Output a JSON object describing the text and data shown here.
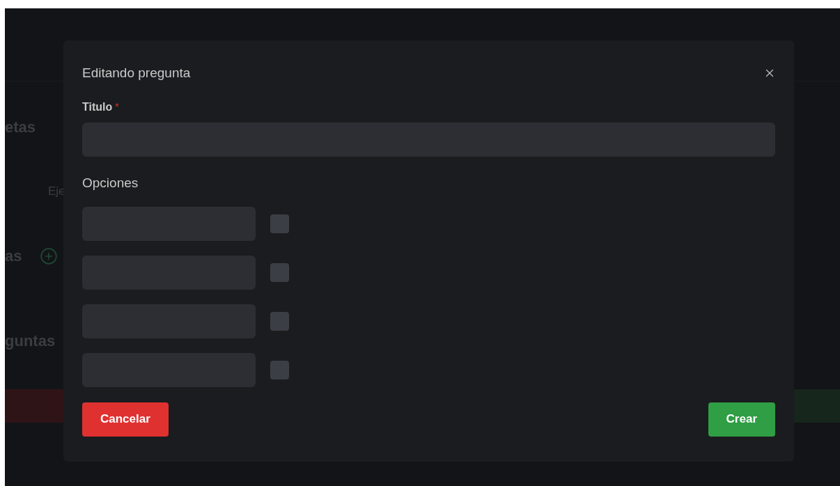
{
  "background": {
    "headings": [
      {
        "text": "etas"
      },
      {
        "text": "Eje"
      },
      {
        "text": "as"
      },
      {
        "text": "guntas"
      }
    ]
  },
  "dialog": {
    "title": "Editando pregunta",
    "title_field": {
      "label": "Titulo",
      "required_mark": "*"
    },
    "options_label": "Opciones",
    "options": [
      {
        "checked": false
      },
      {
        "checked": false
      },
      {
        "checked": false
      },
      {
        "checked": false
      }
    ],
    "buttons": [
      {
        "label": "Cancelar",
        "kind": "danger"
      },
      {
        "label": "Crear",
        "kind": "primary"
      }
    ]
  }
}
